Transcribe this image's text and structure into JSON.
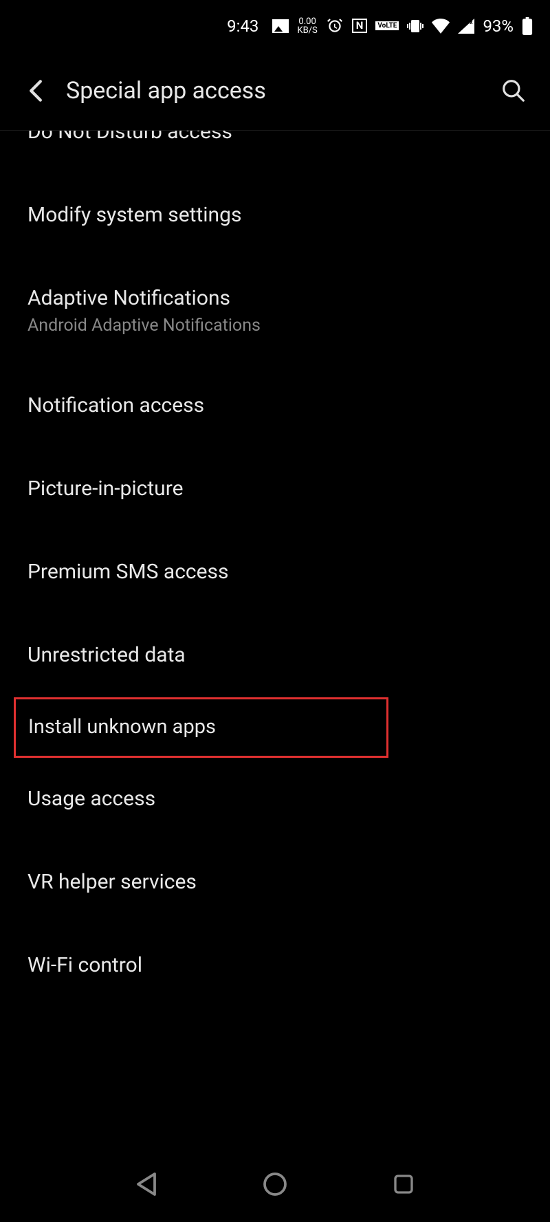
{
  "status_bar": {
    "time": "9:43",
    "network_speed_value": "0.00",
    "network_speed_unit": "KB/S",
    "nfc_label": "N",
    "volte_top": "Vo",
    "volte_bottom": "LTE",
    "battery_percent": "93%"
  },
  "app_bar": {
    "title": "Special app access"
  },
  "list": {
    "items": [
      {
        "title": "Do Not Disturb access",
        "subtitle": "",
        "cutoff": true,
        "highlighted": false
      },
      {
        "title": "Modify system settings",
        "subtitle": "",
        "cutoff": false,
        "highlighted": false
      },
      {
        "title": "Adaptive Notifications",
        "subtitle": "Android Adaptive Notifications",
        "cutoff": false,
        "highlighted": false
      },
      {
        "title": "Notification access",
        "subtitle": "",
        "cutoff": false,
        "highlighted": false
      },
      {
        "title": "Picture-in-picture",
        "subtitle": "",
        "cutoff": false,
        "highlighted": false
      },
      {
        "title": "Premium SMS access",
        "subtitle": "",
        "cutoff": false,
        "highlighted": false
      },
      {
        "title": "Unrestricted data",
        "subtitle": "",
        "cutoff": false,
        "highlighted": false
      },
      {
        "title": "Install unknown apps",
        "subtitle": "",
        "cutoff": false,
        "highlighted": true
      },
      {
        "title": "Usage access",
        "subtitle": "",
        "cutoff": false,
        "highlighted": false
      },
      {
        "title": "VR helper services",
        "subtitle": "",
        "cutoff": false,
        "highlighted": false
      },
      {
        "title": "Wi-Fi control",
        "subtitle": "",
        "cutoff": false,
        "highlighted": false
      }
    ]
  }
}
